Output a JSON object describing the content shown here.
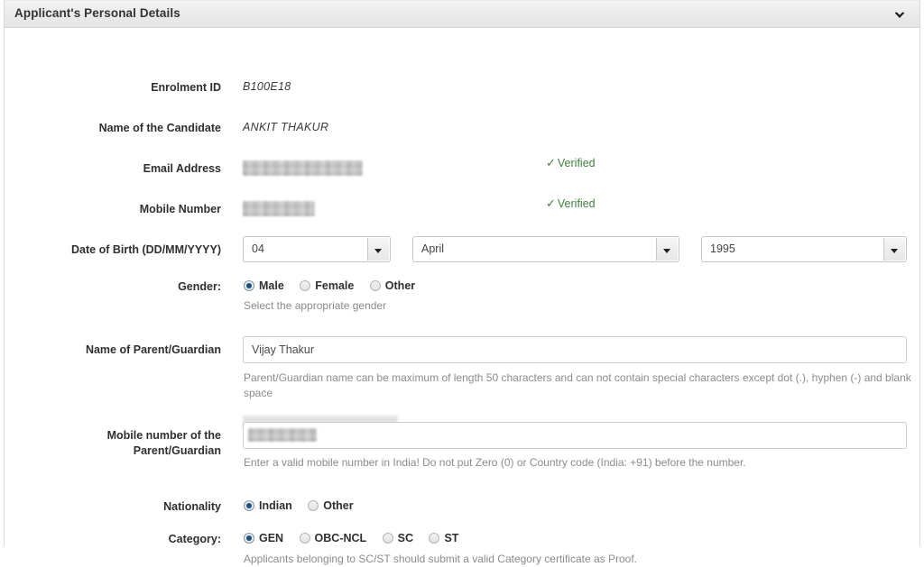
{
  "panel": {
    "title": "Applicant's Personal Details",
    "collapse_icon": "chevron-down-icon"
  },
  "fields": {
    "enrolment_id": {
      "label": "Enrolment ID",
      "value": "B100E18"
    },
    "candidate_name": {
      "label": "Name of the Candidate",
      "value": "ANKIT THAKUR"
    },
    "email": {
      "label": "Email Address",
      "value": "",
      "redacted": true,
      "status": "Verified",
      "status_icon": "check-icon",
      "status_color": "#3f7d3f"
    },
    "mobile": {
      "label": "Mobile Number",
      "value": "",
      "redacted": true,
      "status": "Verified",
      "status_icon": "check-icon",
      "status_color": "#3f7d3f"
    },
    "dob": {
      "label": "Date of Birth (DD/MM/YYYY)",
      "day": "04",
      "month": "April",
      "year": "1995"
    },
    "gender": {
      "label": "Gender:",
      "options": [
        {
          "label": "Male",
          "checked": true
        },
        {
          "label": "Female",
          "checked": false
        },
        {
          "label": "Other",
          "checked": false
        }
      ],
      "hint": "Select the appropriate gender"
    },
    "parent_name": {
      "label": "Name of Parent/Guardian",
      "value": "Vijay Thakur",
      "hint": "Parent/Guardian name can be maximum of length 50 characters and can not contain special characters except dot (.), hyphen (-) and blank space"
    },
    "parent_mobile": {
      "label_line1": "Mobile number of the",
      "label_line2": "Parent/Guardian",
      "value": "",
      "redacted": true,
      "hint": "Enter a valid mobile number in India! Do not put Zero (0) or Country code (India: +91) before the number."
    },
    "nationality": {
      "label": "Nationality",
      "options": [
        {
          "label": "Indian",
          "checked": true
        },
        {
          "label": "Other",
          "checked": false
        }
      ]
    },
    "category": {
      "label": "Category:",
      "options": [
        {
          "label": "GEN",
          "checked": true
        },
        {
          "label": "OBC-NCL",
          "checked": false
        },
        {
          "label": "SC",
          "checked": false
        },
        {
          "label": "ST",
          "checked": false
        }
      ],
      "hint": "Applicants belonging to SC/ST should submit a valid Category certificate as Proof."
    }
  }
}
